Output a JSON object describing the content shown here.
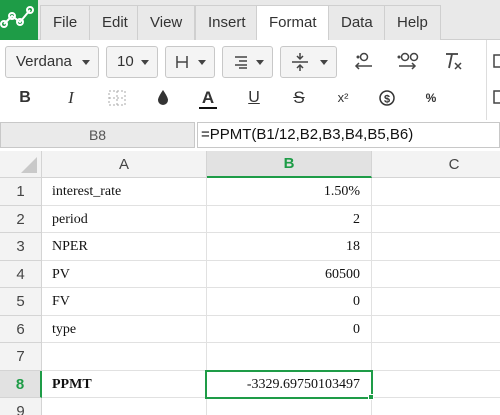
{
  "menu": {
    "items": [
      "File",
      "Edit",
      "View",
      "Insert",
      "Format",
      "Data",
      "Help"
    ],
    "active": "Format"
  },
  "toolbar": {
    "font_name": "Verdana",
    "font_size": "10",
    "icons": [
      "border-icon",
      "align-icon",
      "valign-icon",
      "decrease-decimal-icon",
      "increase-decimal-icon",
      "clear-format-icon",
      "bold-icon",
      "italic-icon",
      "merge-icon",
      "fill-color-icon",
      "text-color-icon",
      "underline-icon",
      "strikethrough-icon",
      "superscript-icon",
      "currency-icon",
      "percent-icon"
    ],
    "bold": "B",
    "italic": "I",
    "text_color": "A",
    "underline": "U",
    "strike": "S",
    "superscript": "x²",
    "currency": "$",
    "percent": "%"
  },
  "formula_bar": {
    "cell_ref": "B8",
    "formula": "=PPMT(B1/12,B2,B3,B4,B5,B6)"
  },
  "sheet": {
    "columns": [
      "A",
      "B",
      "C"
    ],
    "selected_column": "B",
    "selected_row": "8",
    "rows": [
      {
        "num": "1",
        "a": "interest_rate",
        "b": "1.50%"
      },
      {
        "num": "2",
        "a": "period",
        "b": "2"
      },
      {
        "num": "3",
        "a": "NPER",
        "b": "18"
      },
      {
        "num": "4",
        "a": "PV",
        "b": "60500"
      },
      {
        "num": "5",
        "a": "FV",
        "b": "0"
      },
      {
        "num": "6",
        "a": "type",
        "b": "0"
      },
      {
        "num": "7",
        "a": "",
        "b": ""
      },
      {
        "num": "8",
        "a": "PPMT",
        "b": "-3329.69750103497"
      },
      {
        "num": "9",
        "a": "",
        "b": ""
      }
    ]
  },
  "colors": {
    "accent": "#1e9c47"
  }
}
